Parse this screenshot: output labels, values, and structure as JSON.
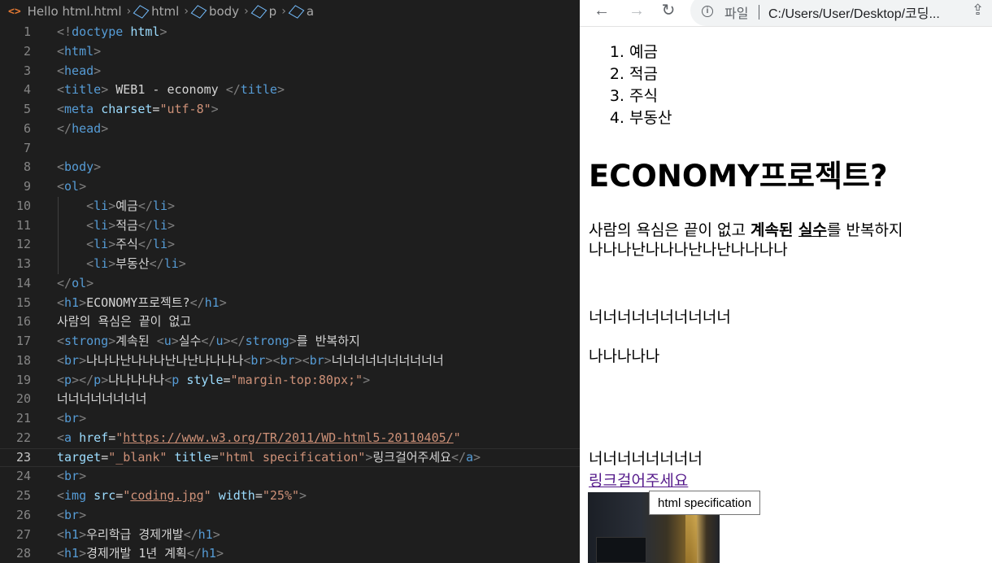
{
  "editor": {
    "breadcrumbs": [
      "Hello html.html",
      "html",
      "body",
      "p",
      "a"
    ],
    "current_line": 23,
    "lines": [
      [
        {
          "c": "tg",
          "t": "<!"
        },
        {
          "c": "nm",
          "t": "doctype"
        },
        {
          "c": "tx",
          "t": " "
        },
        {
          "c": "at",
          "t": "html"
        },
        {
          "c": "tg",
          "t": ">"
        }
      ],
      [
        {
          "c": "tg",
          "t": "<"
        },
        {
          "c": "nm",
          "t": "html"
        },
        {
          "c": "tg",
          "t": ">"
        }
      ],
      [
        {
          "c": "tg",
          "t": "<"
        },
        {
          "c": "nm",
          "t": "head"
        },
        {
          "c": "tg",
          "t": ">"
        }
      ],
      [
        {
          "c": "tg",
          "t": "<"
        },
        {
          "c": "nm",
          "t": "title"
        },
        {
          "c": "tg",
          "t": ">"
        },
        {
          "c": "tx",
          "t": " WEB1 - economy "
        },
        {
          "c": "tg",
          "t": "</"
        },
        {
          "c": "nm",
          "t": "title"
        },
        {
          "c": "tg",
          "t": ">"
        }
      ],
      [
        {
          "c": "tg",
          "t": "<"
        },
        {
          "c": "nm",
          "t": "meta"
        },
        {
          "c": "tx",
          "t": " "
        },
        {
          "c": "at",
          "t": "charset"
        },
        {
          "c": "tx",
          "t": "="
        },
        {
          "c": "st",
          "t": "\"utf-8\""
        },
        {
          "c": "tg",
          "t": ">"
        }
      ],
      [
        {
          "c": "tg",
          "t": "</"
        },
        {
          "c": "nm",
          "t": "head"
        },
        {
          "c": "tg",
          "t": ">"
        }
      ],
      [],
      [
        {
          "c": "tg",
          "t": "<"
        },
        {
          "c": "nm",
          "t": "body"
        },
        {
          "c": "tg",
          "t": ">"
        }
      ],
      [
        {
          "c": "tg",
          "t": "<"
        },
        {
          "c": "nm",
          "t": "ol"
        },
        {
          "c": "tg",
          "t": ">"
        }
      ],
      [
        {
          "c": "tx",
          "t": "    "
        },
        {
          "c": "tg",
          "t": "<"
        },
        {
          "c": "nm",
          "t": "li"
        },
        {
          "c": "tg",
          "t": ">"
        },
        {
          "c": "tx",
          "t": "예금"
        },
        {
          "c": "tg",
          "t": "</"
        },
        {
          "c": "nm",
          "t": "li"
        },
        {
          "c": "tg",
          "t": ">"
        }
      ],
      [
        {
          "c": "tx",
          "t": "    "
        },
        {
          "c": "tg",
          "t": "<"
        },
        {
          "c": "nm",
          "t": "li"
        },
        {
          "c": "tg",
          "t": ">"
        },
        {
          "c": "tx",
          "t": "적금"
        },
        {
          "c": "tg",
          "t": "</"
        },
        {
          "c": "nm",
          "t": "li"
        },
        {
          "c": "tg",
          "t": ">"
        }
      ],
      [
        {
          "c": "tx",
          "t": "    "
        },
        {
          "c": "tg",
          "t": "<"
        },
        {
          "c": "nm",
          "t": "li"
        },
        {
          "c": "tg",
          "t": ">"
        },
        {
          "c": "tx",
          "t": "주식"
        },
        {
          "c": "tg",
          "t": "</"
        },
        {
          "c": "nm",
          "t": "li"
        },
        {
          "c": "tg",
          "t": ">"
        }
      ],
      [
        {
          "c": "tx",
          "t": "    "
        },
        {
          "c": "tg",
          "t": "<"
        },
        {
          "c": "nm",
          "t": "li"
        },
        {
          "c": "tg",
          "t": ">"
        },
        {
          "c": "tx",
          "t": "부동산"
        },
        {
          "c": "tg",
          "t": "</"
        },
        {
          "c": "nm",
          "t": "li"
        },
        {
          "c": "tg",
          "t": ">"
        }
      ],
      [
        {
          "c": "tg",
          "t": "</"
        },
        {
          "c": "nm",
          "t": "ol"
        },
        {
          "c": "tg",
          "t": ">"
        }
      ],
      [
        {
          "c": "tg",
          "t": "<"
        },
        {
          "c": "nm",
          "t": "h1"
        },
        {
          "c": "tg",
          "t": ">"
        },
        {
          "c": "tx",
          "t": "ECONOMY프로젝트?"
        },
        {
          "c": "tg",
          "t": "</"
        },
        {
          "c": "nm",
          "t": "h1"
        },
        {
          "c": "tg",
          "t": ">"
        }
      ],
      [
        {
          "c": "tx",
          "t": "사람의 욕심은 끝이 없고"
        }
      ],
      [
        {
          "c": "tg",
          "t": "<"
        },
        {
          "c": "nm",
          "t": "strong"
        },
        {
          "c": "tg",
          "t": ">"
        },
        {
          "c": "tx",
          "t": "계속된 "
        },
        {
          "c": "tg",
          "t": "<"
        },
        {
          "c": "nm",
          "t": "u"
        },
        {
          "c": "tg",
          "t": ">"
        },
        {
          "c": "tx",
          "t": "실수"
        },
        {
          "c": "tg",
          "t": "</"
        },
        {
          "c": "nm",
          "t": "u"
        },
        {
          "c": "tg",
          "t": "></"
        },
        {
          "c": "nm",
          "t": "strong"
        },
        {
          "c": "tg",
          "t": ">"
        },
        {
          "c": "tx",
          "t": "를 반복하지"
        }
      ],
      [
        {
          "c": "tg",
          "t": "<"
        },
        {
          "c": "nm",
          "t": "br"
        },
        {
          "c": "tg",
          "t": ">"
        },
        {
          "c": "tx",
          "t": "나나나난나나나난나난나나나나"
        },
        {
          "c": "tg",
          "t": "<"
        },
        {
          "c": "nm",
          "t": "br"
        },
        {
          "c": "tg",
          "t": "><"
        },
        {
          "c": "nm",
          "t": "br"
        },
        {
          "c": "tg",
          "t": "><"
        },
        {
          "c": "nm",
          "t": "br"
        },
        {
          "c": "tg",
          "t": ">"
        },
        {
          "c": "tx",
          "t": "너너너너너너너너너너"
        }
      ],
      [
        {
          "c": "tg",
          "t": "<"
        },
        {
          "c": "nm",
          "t": "p"
        },
        {
          "c": "tg",
          "t": "></"
        },
        {
          "c": "nm",
          "t": "p"
        },
        {
          "c": "tg",
          "t": ">"
        },
        {
          "c": "tx",
          "t": "나나나나나"
        },
        {
          "c": "tg",
          "t": "<"
        },
        {
          "c": "nm",
          "t": "p"
        },
        {
          "c": "tx",
          "t": " "
        },
        {
          "c": "at",
          "t": "style"
        },
        {
          "c": "tx",
          "t": "="
        },
        {
          "c": "st",
          "t": "\"margin-top:80px;\""
        },
        {
          "c": "tg",
          "t": ">"
        }
      ],
      [
        {
          "c": "tx",
          "t": "너너너너너너너너"
        }
      ],
      [
        {
          "c": "tg",
          "t": "<"
        },
        {
          "c": "nm",
          "t": "br"
        },
        {
          "c": "tg",
          "t": ">"
        }
      ],
      [
        {
          "c": "tg",
          "t": "<"
        },
        {
          "c": "nm",
          "t": "a"
        },
        {
          "c": "tx",
          "t": " "
        },
        {
          "c": "at",
          "t": "href"
        },
        {
          "c": "tx",
          "t": "="
        },
        {
          "c": "st",
          "t": "\""
        },
        {
          "c": "st ul",
          "t": "https://www.w3.org/TR/2011/WD-html5-20110405/"
        },
        {
          "c": "st",
          "t": "\""
        }
      ],
      [
        {
          "c": "at",
          "t": "target"
        },
        {
          "c": "tx",
          "t": "="
        },
        {
          "c": "st",
          "t": "\"_blank\""
        },
        {
          "c": "tx",
          "t": " "
        },
        {
          "c": "at",
          "t": "title"
        },
        {
          "c": "tx",
          "t": "="
        },
        {
          "c": "st",
          "t": "\"html specification\""
        },
        {
          "c": "tg",
          "t": ">"
        },
        {
          "c": "tx",
          "t": "링크걸어주세요"
        },
        {
          "c": "tg",
          "t": "</"
        },
        {
          "c": "nm",
          "t": "a"
        },
        {
          "c": "tg",
          "t": ">"
        }
      ],
      [
        {
          "c": "tg",
          "t": "<"
        },
        {
          "c": "nm",
          "t": "br"
        },
        {
          "c": "tg",
          "t": ">"
        }
      ],
      [
        {
          "c": "tg",
          "t": "<"
        },
        {
          "c": "nm",
          "t": "img"
        },
        {
          "c": "tx",
          "t": " "
        },
        {
          "c": "at",
          "t": "src"
        },
        {
          "c": "tx",
          "t": "="
        },
        {
          "c": "st",
          "t": "\""
        },
        {
          "c": "st ul",
          "t": "coding.jpg"
        },
        {
          "c": "st",
          "t": "\""
        },
        {
          "c": "tx",
          "t": " "
        },
        {
          "c": "at",
          "t": "width"
        },
        {
          "c": "tx",
          "t": "="
        },
        {
          "c": "st",
          "t": "\"25%\""
        },
        {
          "c": "tg",
          "t": ">"
        }
      ],
      [
        {
          "c": "tg",
          "t": "<"
        },
        {
          "c": "nm",
          "t": "br"
        },
        {
          "c": "tg",
          "t": ">"
        }
      ],
      [
        {
          "c": "tg",
          "t": "<"
        },
        {
          "c": "nm",
          "t": "h1"
        },
        {
          "c": "tg",
          "t": ">"
        },
        {
          "c": "tx",
          "t": "우리학급 경제개발"
        },
        {
          "c": "tg",
          "t": "</"
        },
        {
          "c": "nm",
          "t": "h1"
        },
        {
          "c": "tg",
          "t": ">"
        }
      ],
      [
        {
          "c": "tg",
          "t": "<"
        },
        {
          "c": "nm",
          "t": "h1"
        },
        {
          "c": "tg",
          "t": ">"
        },
        {
          "c": "tx",
          "t": "경제개발 1년 계획"
        },
        {
          "c": "tg",
          "t": "</"
        },
        {
          "c": "nm",
          "t": "h1"
        },
        {
          "c": "tg",
          "t": ">"
        }
      ]
    ]
  },
  "browser": {
    "scheme_label": "파일",
    "url": "C:/Users/User/Desktop/코딩...",
    "list": [
      "예금",
      "적금",
      "주식",
      "부동산"
    ],
    "heading": "ECONOMY프로젝트?",
    "para1_plain": "사람의 욕심은 끝이 없고 ",
    "para1_strong": "계속된 ",
    "para1_strong_u": "실수",
    "para1_tail": "를 반복하지",
    "para2": "나나나난나나나난나난나나나나",
    "para3": "너너너너너너너너너너",
    "para4": "나나나나나",
    "para5": "너너너너너너너너",
    "link_text": "링크걸어주세요",
    "tooltip": "html specification"
  }
}
